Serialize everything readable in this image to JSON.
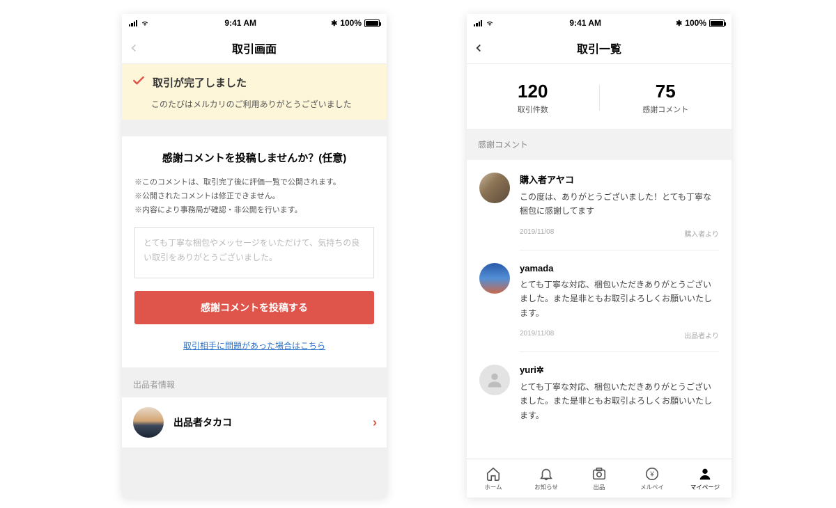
{
  "statusbar": {
    "time": "9:41 AM",
    "bluetooth": "✱",
    "battery_pct": "100%"
  },
  "left": {
    "title": "取引画面",
    "banner_title": "取引が完了しました",
    "banner_sub": "このたびはメルカリのご利用ありがとうございました",
    "card_title": "感謝コメントを投稿しませんか？(任意)",
    "note1": "※このコメントは、取引完了後に評価一覧で公開されます。",
    "note2": "※公開されたコメントは修正できません。",
    "note3": "※内容により事務局が確認・非公開を行います。",
    "textarea_placeholder": "とても丁寧な梱包やメッセージをいただけて、気持ちの良い取引をありがとうございました。",
    "submit_label": "感謝コメントを投稿する",
    "trouble_link": "取引相手に問題があった場合はこちら",
    "seller_section": "出品者情報",
    "seller_name": "出品者タカコ"
  },
  "right": {
    "title": "取引一覧",
    "stat1_num": "120",
    "stat1_lbl": "取引件数",
    "stat2_num": "75",
    "stat2_lbl": "感謝コメント",
    "section_head": "感謝コメント",
    "comments": [
      {
        "name": "購入者アヤコ",
        "text": "この度は、ありがとうございました！とても丁寧な梱包に感謝してます",
        "date": "2019/11/08",
        "role": "購入者より"
      },
      {
        "name": "yamada",
        "text": "とても丁寧な対応、梱包いただきありがとうございました。また是非ともお取引よろしくお願いいたします。",
        "date": "2019/11/08",
        "role": "出品者より"
      },
      {
        "name": "yuri✲",
        "text": "とても丁寧な対応、梱包いただきありがとうございました。また是非ともお取引よろしくお願いいたします。",
        "date": "",
        "role": ""
      }
    ],
    "tabs": {
      "home": "ホーム",
      "notice": "お知らせ",
      "list": "出品",
      "pay": "メルペイ",
      "mypage": "マイページ"
    }
  }
}
